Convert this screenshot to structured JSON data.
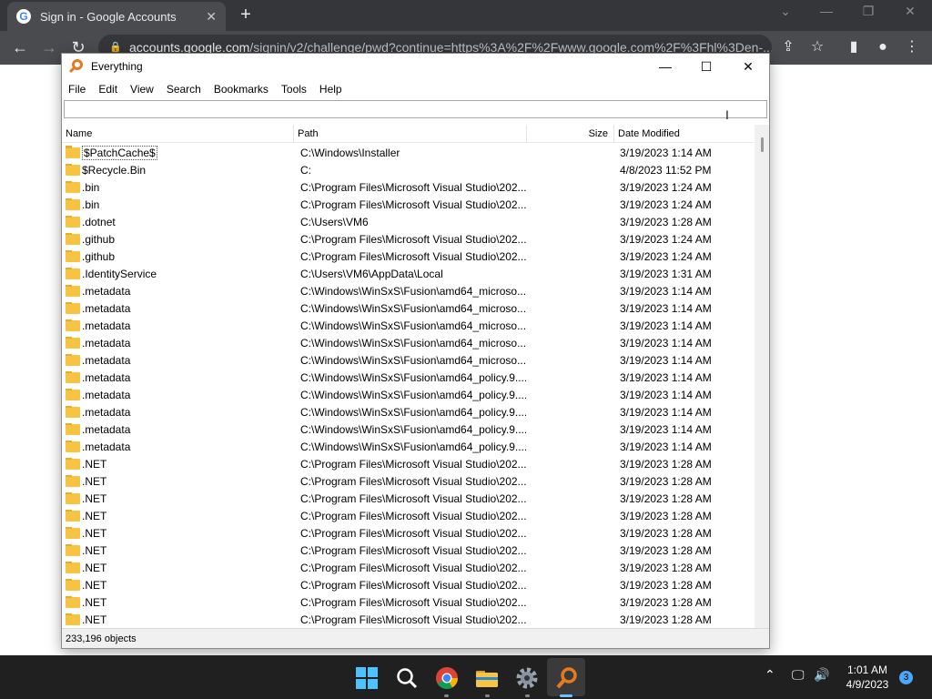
{
  "browser": {
    "tab_title": "Sign in - Google Accounts",
    "favicon_letter": "G",
    "tab_close": "✕",
    "new_tab": "+",
    "url_host": "accounts.google.com",
    "url_rest": "/signin/v2/challenge/pwd?continue=https%3A%2F%2Fwww.google.com%2F%3Fhl%3Den-..."
  },
  "window": {
    "title": "Everything",
    "menu": [
      "File",
      "Edit",
      "View",
      "Search",
      "Bookmarks",
      "Tools",
      "Help"
    ],
    "search_value": "",
    "columns": [
      "Name",
      "Path",
      "Size",
      "Date Modified"
    ],
    "rows": [
      {
        "name": "$PatchCache$",
        "path": "C:\\Windows\\Installer",
        "size": "",
        "date": "3/19/2023 1:14 AM"
      },
      {
        "name": "$Recycle.Bin",
        "path": "C:",
        "size": "",
        "date": "4/8/2023 11:52 PM"
      },
      {
        "name": ".bin",
        "path": "C:\\Program Files\\Microsoft Visual Studio\\202...",
        "size": "",
        "date": "3/19/2023 1:24 AM"
      },
      {
        "name": ".bin",
        "path": "C:\\Program Files\\Microsoft Visual Studio\\202...",
        "size": "",
        "date": "3/19/2023 1:24 AM"
      },
      {
        "name": ".dotnet",
        "path": "C:\\Users\\VM6",
        "size": "",
        "date": "3/19/2023 1:28 AM"
      },
      {
        "name": ".github",
        "path": "C:\\Program Files\\Microsoft Visual Studio\\202...",
        "size": "",
        "date": "3/19/2023 1:24 AM"
      },
      {
        "name": ".github",
        "path": "C:\\Program Files\\Microsoft Visual Studio\\202...",
        "size": "",
        "date": "3/19/2023 1:24 AM"
      },
      {
        "name": ".IdentityService",
        "path": "C:\\Users\\VM6\\AppData\\Local",
        "size": "",
        "date": "3/19/2023 1:31 AM"
      },
      {
        "name": ".metadata",
        "path": "C:\\Windows\\WinSxS\\Fusion\\amd64_microso...",
        "size": "",
        "date": "3/19/2023 1:14 AM"
      },
      {
        "name": ".metadata",
        "path": "C:\\Windows\\WinSxS\\Fusion\\amd64_microso...",
        "size": "",
        "date": "3/19/2023 1:14 AM"
      },
      {
        "name": ".metadata",
        "path": "C:\\Windows\\WinSxS\\Fusion\\amd64_microso...",
        "size": "",
        "date": "3/19/2023 1:14 AM"
      },
      {
        "name": ".metadata",
        "path": "C:\\Windows\\WinSxS\\Fusion\\amd64_microso...",
        "size": "",
        "date": "3/19/2023 1:14 AM"
      },
      {
        "name": ".metadata",
        "path": "C:\\Windows\\WinSxS\\Fusion\\amd64_microso...",
        "size": "",
        "date": "3/19/2023 1:14 AM"
      },
      {
        "name": ".metadata",
        "path": "C:\\Windows\\WinSxS\\Fusion\\amd64_policy.9....",
        "size": "",
        "date": "3/19/2023 1:14 AM"
      },
      {
        "name": ".metadata",
        "path": "C:\\Windows\\WinSxS\\Fusion\\amd64_policy.9....",
        "size": "",
        "date": "3/19/2023 1:14 AM"
      },
      {
        "name": ".metadata",
        "path": "C:\\Windows\\WinSxS\\Fusion\\amd64_policy.9....",
        "size": "",
        "date": "3/19/2023 1:14 AM"
      },
      {
        "name": ".metadata",
        "path": "C:\\Windows\\WinSxS\\Fusion\\amd64_policy.9....",
        "size": "",
        "date": "3/19/2023 1:14 AM"
      },
      {
        "name": ".metadata",
        "path": "C:\\Windows\\WinSxS\\Fusion\\amd64_policy.9....",
        "size": "",
        "date": "3/19/2023 1:14 AM"
      },
      {
        "name": ".NET",
        "path": "C:\\Program Files\\Microsoft Visual Studio\\202...",
        "size": "",
        "date": "3/19/2023 1:28 AM"
      },
      {
        "name": ".NET",
        "path": "C:\\Program Files\\Microsoft Visual Studio\\202...",
        "size": "",
        "date": "3/19/2023 1:28 AM"
      },
      {
        "name": ".NET",
        "path": "C:\\Program Files\\Microsoft Visual Studio\\202...",
        "size": "",
        "date": "3/19/2023 1:28 AM"
      },
      {
        "name": ".NET",
        "path": "C:\\Program Files\\Microsoft Visual Studio\\202...",
        "size": "",
        "date": "3/19/2023 1:28 AM"
      },
      {
        "name": ".NET",
        "path": "C:\\Program Files\\Microsoft Visual Studio\\202...",
        "size": "",
        "date": "3/19/2023 1:28 AM"
      },
      {
        "name": ".NET",
        "path": "C:\\Program Files\\Microsoft Visual Studio\\202...",
        "size": "",
        "date": "3/19/2023 1:28 AM"
      },
      {
        "name": ".NET",
        "path": "C:\\Program Files\\Microsoft Visual Studio\\202...",
        "size": "",
        "date": "3/19/2023 1:28 AM"
      },
      {
        "name": ".NET",
        "path": "C:\\Program Files\\Microsoft Visual Studio\\202...",
        "size": "",
        "date": "3/19/2023 1:28 AM"
      },
      {
        "name": ".NET",
        "path": "C:\\Program Files\\Microsoft Visual Studio\\202...",
        "size": "",
        "date": "3/19/2023 1:28 AM"
      },
      {
        "name": ".NET",
        "path": "C:\\Program Files\\Microsoft Visual Studio\\202...",
        "size": "",
        "date": "3/19/2023 1:28 AM"
      }
    ],
    "status": "233,196 objects"
  },
  "taskbar": {
    "time": "1:01 AM",
    "date": "4/9/2023",
    "notification_count": "3",
    "icons": [
      "windows-start-icon",
      "search-icon",
      "chrome-icon",
      "file-explorer-icon",
      "settings-icon",
      "everything-icon"
    ]
  },
  "colors": {
    "chrome_dark": "#35363a",
    "chrome_toolbar": "#4a4b4f",
    "folder": "#f6c343",
    "everything_accent": "#e87a1e",
    "taskbar": "#202020",
    "active_indicator": "#6ec1ff"
  }
}
